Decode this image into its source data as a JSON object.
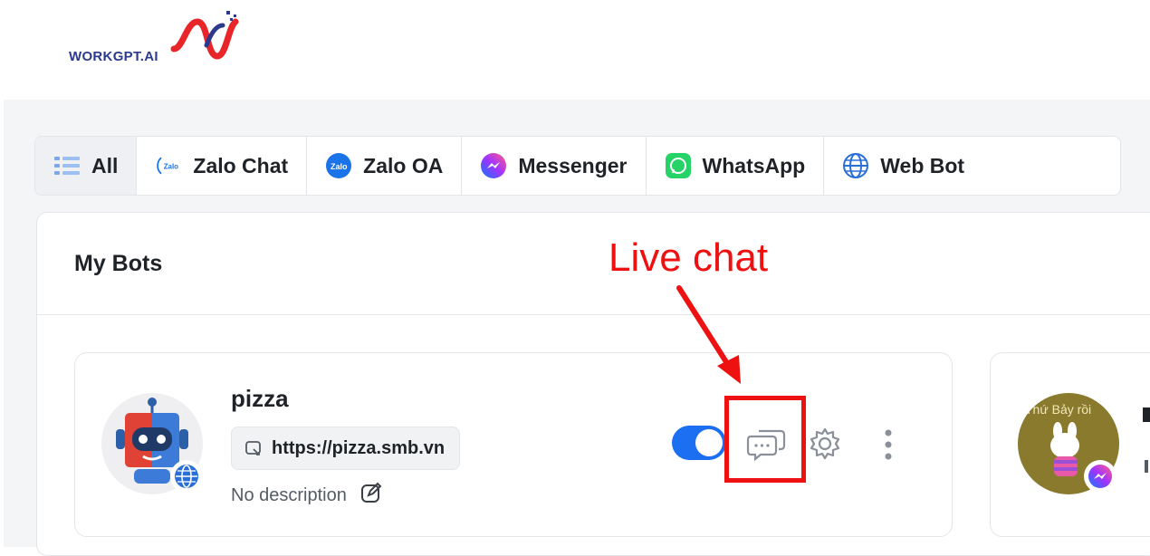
{
  "brand": {
    "name": "WORKGPT.AI",
    "accent": "#2b3a8c",
    "accent2": "#e8262a"
  },
  "tabs": [
    {
      "label": "All",
      "icon": "list-icon",
      "active": true
    },
    {
      "label": "Zalo Chat",
      "icon": "zalo-chat-icon",
      "active": false
    },
    {
      "label": "Zalo OA",
      "icon": "zalo-oa-icon",
      "active": false
    },
    {
      "label": "Messenger",
      "icon": "messenger-icon",
      "active": false
    },
    {
      "label": "WhatsApp",
      "icon": "whatsapp-icon",
      "active": false
    },
    {
      "label": "Web Bot",
      "icon": "globe-icon",
      "active": false
    }
  ],
  "section": {
    "title": "My Bots"
  },
  "bots": [
    {
      "name": "pizza",
      "url": "https://pizza.smb.vn",
      "description": "No description",
      "enabled": true,
      "channel_icon": "globe-icon"
    },
    {
      "avatar_caption": "Thứ Bảy rồi",
      "channel_icon": "messenger-icon"
    }
  ],
  "annotation": {
    "text": "Live chat",
    "color": "#ee1111"
  },
  "icons": {
    "zalo_small_text": "Zalo"
  },
  "colors": {
    "toggle_on": "#1d6ff2",
    "page_bg": "#f4f5f7"
  }
}
